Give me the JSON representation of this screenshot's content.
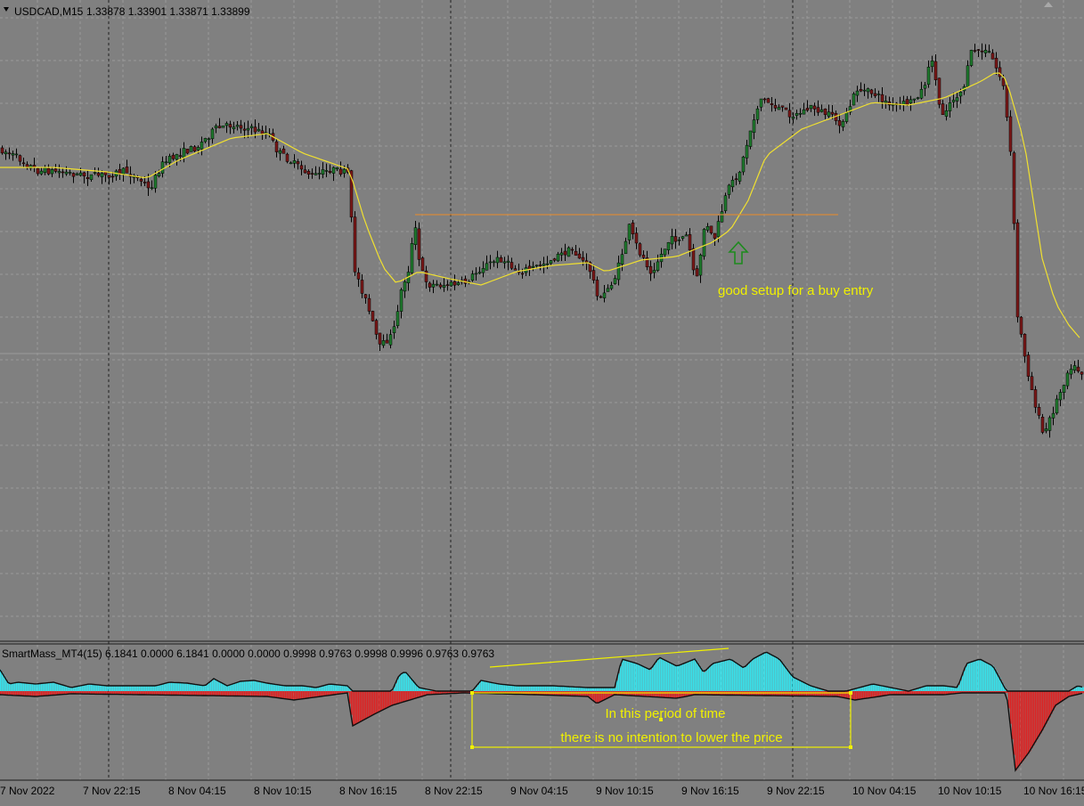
{
  "chart_header": {
    "symbol": "USDCAD,M15",
    "ohlc": "1.33878 1.33901 1.33871 1.33899"
  },
  "indicator_header": {
    "name": "SmartMass_MT4(15)",
    "values": "6.1841 0.0000 6.1841 0.0000 0.0000 0.9998 0.9763 0.9998 0.9996 0.9763 0.9763"
  },
  "annotations": {
    "buy_setup": "good setup for a buy entry",
    "box_line1": "In this period of time",
    "box_line2": "there is no intention to lower the price"
  },
  "time_axis": [
    "7 Nov 2022",
    "7 Nov 22:15",
    "8 Nov 04:15",
    "8 Nov 10:15",
    "8 Nov 16:15",
    "8 Nov 22:15",
    "9 Nov 04:15",
    "9 Nov 10:15",
    "9 Nov 16:15",
    "9 Nov 22:15",
    "10 Nov 04:15",
    "10 Nov 10:15",
    "10 Nov 16:15"
  ],
  "colors": {
    "background": "#808080",
    "grid": "#9a9a9a",
    "bull_candle": "#1f7a2e",
    "bear_candle": "#7a1818",
    "moving_average": "#f0e030",
    "resistance_line": "#d58a3a",
    "histogram_positive": "#33e6f0",
    "histogram_negative": "#e02020",
    "annotation_text": "#f0f000",
    "arrow": "#1e8a1e"
  },
  "icons": {
    "collapse": "triangle-down-icon",
    "scroll": "triangle-up-icon",
    "buy_arrow": "arrow-up-icon"
  },
  "chart_data": {
    "type": "candlestick",
    "symbol": "USDCAD",
    "timeframe": "M15",
    "last_bar": {
      "open": 1.33878,
      "high": 1.33901,
      "low": 1.33871,
      "close": 1.33899
    },
    "x_tick_labels": [
      "7 Nov 2022",
      "7 Nov 22:15",
      "8 Nov 04:15",
      "8 Nov 10:15",
      "8 Nov 16:15",
      "8 Nov 22:15",
      "9 Nov 04:15",
      "9 Nov 10:15",
      "9 Nov 16:15",
      "9 Nov 22:15",
      "10 Nov 04:15",
      "10 Nov 10:15",
      "10 Nov 16:15"
    ],
    "indicator": {
      "name": "SmartMass_MT4(15)",
      "values": [
        6.1841,
        0.0,
        6.1841,
        0.0,
        0.0,
        0.9998,
        0.9763,
        0.9998,
        0.9996,
        0.9763,
        0.9763
      ]
    },
    "grid": true
  }
}
